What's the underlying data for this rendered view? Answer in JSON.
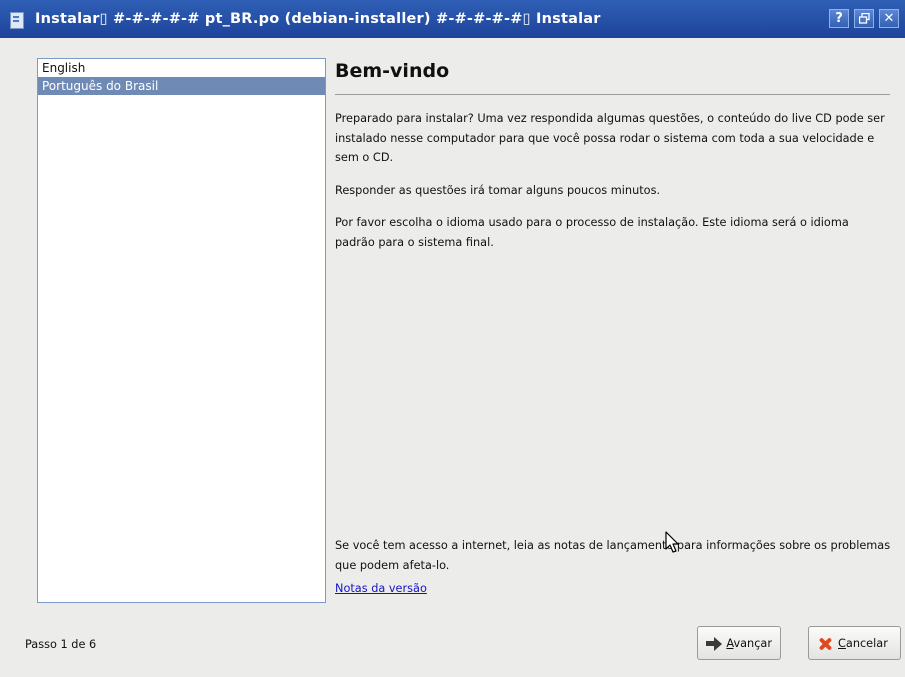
{
  "window": {
    "title": "Instalar▯ #-#-#-#-#  pt_BR.po (debian-installer)  #-#-#-#-#▯ Instalar",
    "buttons": {
      "help": "?",
      "restore": "🗗",
      "close": "✕"
    }
  },
  "language_list": {
    "items": [
      {
        "label": "English",
        "selected": false
      },
      {
        "label": "Português do Brasil",
        "selected": true
      }
    ]
  },
  "content": {
    "heading": "Bem-vindo",
    "paragraphs": [
      "Preparado para instalar? Uma vez respondida algumas questões, o conteúdo do live CD pode ser instalado nesse computador para que você possa rodar o sistema com toda a sua velocidade e sem o CD.",
      "Responder as questões irá tomar alguns poucos minutos.",
      "Por favor escolha o idioma usado para o processo de instalação. Este idioma será o idioma padrão para o sistema final."
    ],
    "internet_note": "Se você tem acesso a internet, leia as notas de lançamento para informações sobre os problemas que podem afeta-lo.",
    "release_notes_link": "Notas da versão"
  },
  "footer": {
    "step": "Passo 1 de 6",
    "next_button": {
      "mnemonic": "A",
      "rest": "vançar"
    },
    "cancel_button": {
      "mnemonic": "C",
      "rest": "ancelar"
    }
  },
  "icons": {
    "app": "installer-icon",
    "next": "arrow-right-icon",
    "cancel": "cancel-x-icon",
    "cursor": "mouse-pointer-icon"
  },
  "colors": {
    "titlebar": "#2f5fb6",
    "selection": "#6e8ab5",
    "link": "#1414c8",
    "cancel_icon": "#e0481f"
  }
}
